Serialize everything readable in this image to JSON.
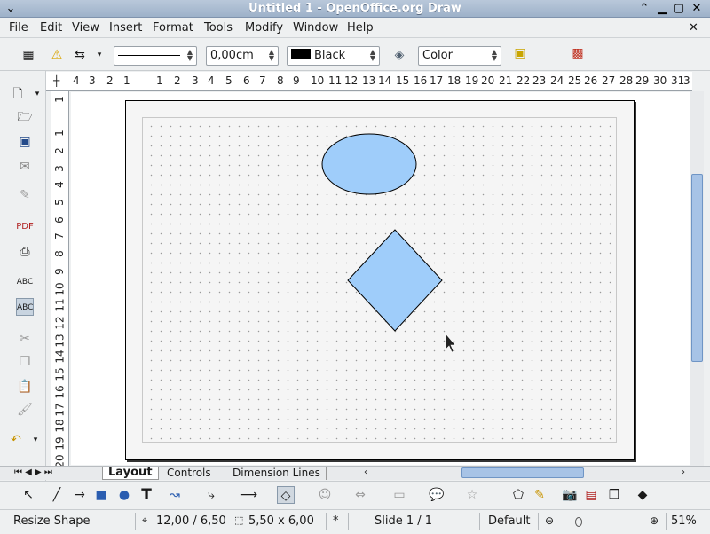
{
  "window": {
    "title": "Untitled 1 - OpenOffice.org Draw"
  },
  "menu": [
    "File",
    "Edit",
    "View",
    "Insert",
    "Format",
    "Tools",
    "Modify",
    "Window",
    "Help"
  ],
  "toolbar": {
    "line_width": "0,00cm",
    "line_color": "Black",
    "area_style": "Color",
    "line_color_hex": "#000000"
  },
  "ruler": {
    "horizontal": [
      "4",
      "3",
      "2",
      "1",
      "1",
      "2",
      "3",
      "4",
      "5",
      "6",
      "7",
      "8",
      "9",
      "10",
      "11",
      "12",
      "13",
      "14",
      "15",
      "16",
      "17",
      "18",
      "19",
      "20",
      "21",
      "22",
      "23",
      "24",
      "25",
      "26",
      "27",
      "28",
      "29",
      "30",
      "31",
      "3"
    ],
    "vertical": [
      "1",
      "1",
      "2",
      "3",
      "4",
      "5",
      "6",
      "7",
      "8",
      "9",
      "10",
      "11",
      "12",
      "13",
      "14",
      "15",
      "16",
      "17",
      "18",
      "19",
      "20"
    ]
  },
  "shapes": {
    "fill_color": "#9fcdfa",
    "stroke_color": "#000000"
  },
  "tabs": [
    "Layout",
    "Controls",
    "Dimension Lines"
  ],
  "status": {
    "action": "Resize Shape",
    "position": "12,00 / 6,50",
    "size": "5,50 x 6,00",
    "modified": "*",
    "slide": "Slide 1 / 1",
    "layout": "Default",
    "zoom": "51%"
  }
}
